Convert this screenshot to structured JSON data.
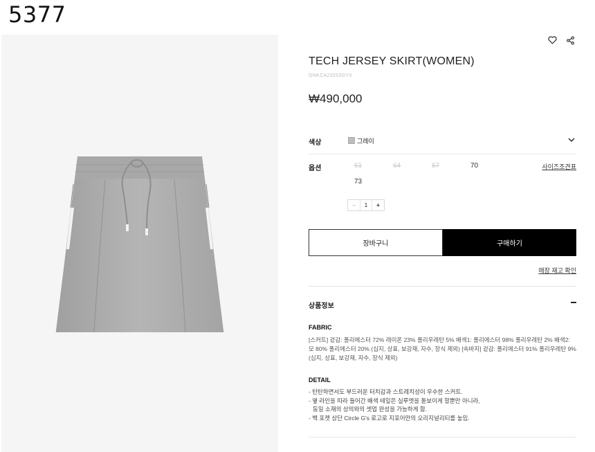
{
  "brand": "5377",
  "product": {
    "title": "TECH JERSEY SKIRT(WOMEN)",
    "code": "GNKCA23253GYX",
    "price": "₩490,000"
  },
  "icons": {
    "wishlist": "heart-icon",
    "share": "share-icon",
    "expand": "chevron-down-icon",
    "collapse": "minus-icon"
  },
  "color_row": {
    "label": "색상",
    "swatch_color": "#bdbdbd",
    "value": "그레이"
  },
  "option_row": {
    "label": "옵션",
    "sizes": [
      {
        "label": "61",
        "available": false
      },
      {
        "label": "64",
        "available": false
      },
      {
        "label": "67",
        "available": false
      },
      {
        "label": "70",
        "available": true
      },
      {
        "label": "73",
        "available": true
      }
    ],
    "size_guide": "사이즈조견표"
  },
  "quantity": {
    "minus": "−",
    "value": "1",
    "plus": "+"
  },
  "buttons": {
    "cart": "장바구니",
    "buy": "구매하기"
  },
  "store_stock_link": "매장 재고 확인",
  "info_section": {
    "title": "상품정보",
    "fabric_heading": "FABRIC",
    "fabric_text": "[스커트] 겉감: 폴리에스터 72% 레이온 23% 폴리우레탄 5% 배색1: 폴리에스터 98% 폴리우레탄 2% 배색2: 모 80% 폴리에스터 20% (심지, 상표, 보강재, 자수, 장식 제외) [속바지] 겉감: 폴리에스터 91% 폴리우레탄 9% (심지, 상표, 보강재, 자수, 장식 제외)",
    "detail_heading": "DETAIL",
    "detail_items": [
      "- 탄탄하면서도 부드러운 터치감과 스트레치성이 우수한 스커트.",
      "- 옆 라인을 따라 들어간 배색 테잎은 실루엣을 돋보이게 할뿐만 아니라,",
      "  동일 소재의 상의와의 셋업 완성을 가능하게 함.",
      "- 백 포켓 상단 Circle G's 로고로 지포어만의 오리지널리티를 높임."
    ]
  }
}
